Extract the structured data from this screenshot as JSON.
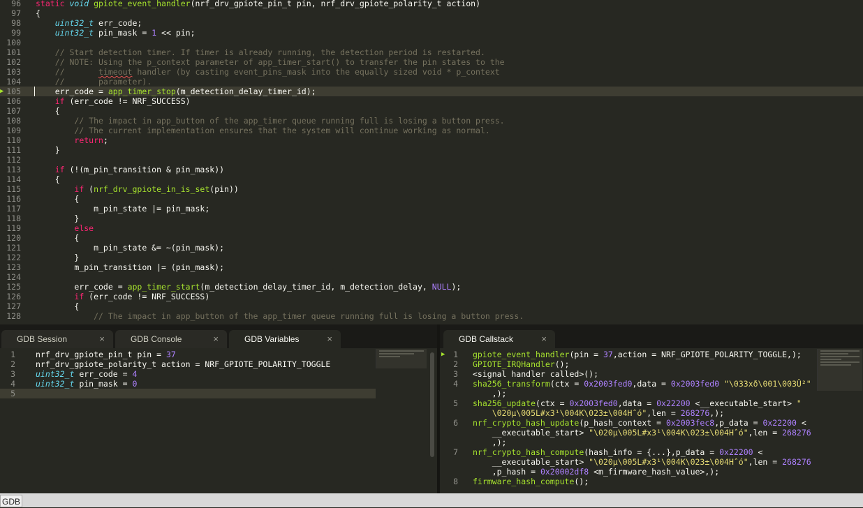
{
  "editor": {
    "lines": [
      {
        "n": "96",
        "t": [
          [
            "kw",
            "static "
          ],
          [
            "typ",
            "void "
          ],
          [
            "fn",
            "gpiote_event_handler"
          ],
          [
            "pln",
            "(nrf_drv_gpiote_pin_t pin, nrf_drv_gpiote_polarity_t action)"
          ]
        ]
      },
      {
        "n": "97",
        "t": [
          [
            "pln",
            "{"
          ]
        ]
      },
      {
        "n": "98",
        "t": [
          [
            "pln",
            "    "
          ],
          [
            "typ",
            "uint32_t"
          ],
          [
            "pln",
            " err_code;"
          ]
        ]
      },
      {
        "n": "99",
        "t": [
          [
            "pln",
            "    "
          ],
          [
            "typ",
            "uint32_t"
          ],
          [
            "pln",
            " pin_mask = "
          ],
          [
            "num",
            "1"
          ],
          [
            "pln",
            " << pin;"
          ]
        ]
      },
      {
        "n": "100",
        "t": []
      },
      {
        "n": "101",
        "t": [
          [
            "cmt",
            "    // Start detection timer. If timer is already running, the detection period is restarted."
          ]
        ]
      },
      {
        "n": "102",
        "t": [
          [
            "cmt",
            "    // NOTE: Using the p_context parameter of app_timer_start() to transfer the pin states to the"
          ]
        ]
      },
      {
        "n": "103",
        "t": [
          [
            "cmt",
            "    //       "
          ],
          [
            "cmt squig",
            "timeout"
          ],
          [
            "cmt",
            " handler (by casting event_pins_mask into the equally sized void * p_context"
          ]
        ]
      },
      {
        "n": "104",
        "t": [
          [
            "cmt",
            "    //       parameter)."
          ]
        ]
      },
      {
        "n": "105",
        "current": true,
        "t": [
          [
            "pln",
            "    err_code = "
          ],
          [
            "fn",
            "app_timer_stop"
          ],
          [
            "pln",
            "(m_detection_delay_timer_id);"
          ]
        ]
      },
      {
        "n": "106",
        "t": [
          [
            "pln",
            "    "
          ],
          [
            "kw",
            "if"
          ],
          [
            "pln",
            " (err_code != NRF_SUCCESS)"
          ]
        ]
      },
      {
        "n": "107",
        "t": [
          [
            "pln",
            "    {"
          ]
        ]
      },
      {
        "n": "108",
        "t": [
          [
            "cmt",
            "        // The impact in app_button of the app_timer queue running full is losing a button press."
          ]
        ]
      },
      {
        "n": "109",
        "t": [
          [
            "cmt",
            "        // The current implementation ensures that the system will continue working as normal."
          ]
        ]
      },
      {
        "n": "110",
        "t": [
          [
            "pln",
            "        "
          ],
          [
            "kw",
            "return"
          ],
          [
            "pln",
            ";"
          ]
        ]
      },
      {
        "n": "111",
        "t": [
          [
            "pln",
            "    }"
          ]
        ]
      },
      {
        "n": "112",
        "t": []
      },
      {
        "n": "113",
        "t": [
          [
            "pln",
            "    "
          ],
          [
            "kw",
            "if"
          ],
          [
            "pln",
            " (!(m_pin_transition & pin_mask))"
          ]
        ]
      },
      {
        "n": "114",
        "t": [
          [
            "pln",
            "    {"
          ]
        ]
      },
      {
        "n": "115",
        "t": [
          [
            "pln",
            "        "
          ],
          [
            "kw",
            "if"
          ],
          [
            "pln",
            " ("
          ],
          [
            "fn",
            "nrf_drv_gpiote_in_is_set"
          ],
          [
            "pln",
            "(pin))"
          ]
        ]
      },
      {
        "n": "116",
        "t": [
          [
            "pln",
            "        {"
          ]
        ]
      },
      {
        "n": "117",
        "t": [
          [
            "pln",
            "            m_pin_state |= pin_mask;"
          ]
        ]
      },
      {
        "n": "118",
        "t": [
          [
            "pln",
            "        }"
          ]
        ]
      },
      {
        "n": "119",
        "t": [
          [
            "pln",
            "        "
          ],
          [
            "kw",
            "else"
          ]
        ]
      },
      {
        "n": "120",
        "t": [
          [
            "pln",
            "        {"
          ]
        ]
      },
      {
        "n": "121",
        "t": [
          [
            "pln",
            "            m_pin_state &= ~(pin_mask);"
          ]
        ]
      },
      {
        "n": "122",
        "t": [
          [
            "pln",
            "        }"
          ]
        ]
      },
      {
        "n": "123",
        "t": [
          [
            "pln",
            "        m_pin_transition |= (pin_mask);"
          ]
        ]
      },
      {
        "n": "124",
        "t": []
      },
      {
        "n": "125",
        "t": [
          [
            "pln",
            "        err_code = "
          ],
          [
            "fn",
            "app_timer_start"
          ],
          [
            "pln",
            "(m_detection_delay_timer_id, m_detection_delay, "
          ],
          [
            "cst",
            "NULL"
          ],
          [
            "pln",
            ");"
          ]
        ]
      },
      {
        "n": "126",
        "t": [
          [
            "pln",
            "        "
          ],
          [
            "kw",
            "if"
          ],
          [
            "pln",
            " (err_code != NRF_SUCCESS)"
          ]
        ]
      },
      {
        "n": "127",
        "t": [
          [
            "pln",
            "        {"
          ]
        ]
      },
      {
        "n": "128",
        "t": [
          [
            "cmt",
            "            // The impact in app_button of the app_timer queue running full is losing a button press."
          ]
        ]
      }
    ]
  },
  "tabs_left": [
    {
      "label": "GDB Session",
      "close": "×"
    },
    {
      "label": "GDB Console",
      "close": "×"
    },
    {
      "label": "GDB Variables",
      "close": "×"
    }
  ],
  "tabs_right": [
    {
      "label": "GDB Callstack",
      "close": "×"
    }
  ],
  "variables": {
    "lines": [
      {
        "n": "1",
        "t": [
          [
            "pln",
            "nrf_drv_gpiote_pin_t pin = "
          ],
          [
            "num",
            "37"
          ]
        ]
      },
      {
        "n": "2",
        "t": [
          [
            "pln",
            "nrf_drv_gpiote_polarity_t action = NRF_GPIOTE_POLARITY_TOGGLE"
          ]
        ]
      },
      {
        "n": "3",
        "t": [
          [
            "typ",
            "uint32_t"
          ],
          [
            "pln",
            " err_code = "
          ],
          [
            "num",
            "4"
          ]
        ]
      },
      {
        "n": "4",
        "t": [
          [
            "typ",
            "uint32_t"
          ],
          [
            "pln",
            " pin_mask = "
          ],
          [
            "num",
            "0"
          ]
        ]
      },
      {
        "n": "5",
        "current": true,
        "t": []
      }
    ]
  },
  "callstack": {
    "lines": [
      {
        "n": "1",
        "t": [
          [
            "fn",
            "gpiote_event_handler"
          ],
          [
            "pln",
            "(pin = "
          ],
          [
            "num",
            "37"
          ],
          [
            "pln",
            ",action = NRF_GPIOTE_POLARITY_TOGGLE,);"
          ]
        ]
      },
      {
        "n": "2",
        "t": [
          [
            "fn",
            "GPIOTE_IRQHandler"
          ],
          [
            "pln",
            "();"
          ]
        ]
      },
      {
        "n": "3",
        "t": [
          [
            "pln",
            "<signal handler called>();"
          ]
        ]
      },
      {
        "n": "4",
        "t": [
          [
            "fn",
            "sha256_transform"
          ],
          [
            "pln",
            "(ctx = "
          ],
          [
            "num",
            "0x2003fed0"
          ],
          [
            "pln",
            ",data = "
          ],
          [
            "num",
            "0x2003fed0"
          ],
          [
            "pln",
            " "
          ],
          [
            "str",
            "\"\\033xð\\001\\003Û²\""
          ]
        ]
      },
      {
        "n": "",
        "t": [
          [
            "pln",
            "    ,);"
          ]
        ]
      },
      {
        "n": "5",
        "t": [
          [
            "fn",
            "sha256_update"
          ],
          [
            "pln",
            "(ctx = "
          ],
          [
            "num",
            "0x2003fed0"
          ],
          [
            "pln",
            ",data = "
          ],
          [
            "num",
            "0x22200"
          ],
          [
            "pln",
            " <__executable_start> "
          ],
          [
            "str",
            "\""
          ]
        ]
      },
      {
        "n": "",
        "t": [
          [
            "str",
            "    \\020µ\\005L#x3¹\\004K\\023±\\004Hˆó\""
          ],
          [
            "pln",
            ",len = "
          ],
          [
            "num",
            "268276"
          ],
          [
            "pln",
            ",);"
          ]
        ]
      },
      {
        "n": "6",
        "t": [
          [
            "fn",
            "nrf_crypto_hash_update"
          ],
          [
            "pln",
            "(p_hash_context = "
          ],
          [
            "num",
            "0x2003fec8"
          ],
          [
            "pln",
            ",p_data = "
          ],
          [
            "num",
            "0x22200"
          ],
          [
            "pln",
            " <"
          ]
        ]
      },
      {
        "n": "",
        "t": [
          [
            "pln",
            "    __executable_start> "
          ],
          [
            "str",
            "\"\\020µ\\005L#x3¹\\004K\\023±\\004Hˆó\""
          ],
          [
            "pln",
            ",len = "
          ],
          [
            "num",
            "268276"
          ]
        ]
      },
      {
        "n": "",
        "t": [
          [
            "pln",
            "    ,);"
          ]
        ]
      },
      {
        "n": "7",
        "t": [
          [
            "fn",
            "nrf_crypto_hash_compute"
          ],
          [
            "pln",
            "(hash_info = {...},p_data = "
          ],
          [
            "num",
            "0x22200"
          ],
          [
            "pln",
            " <"
          ]
        ]
      },
      {
        "n": "",
        "t": [
          [
            "pln",
            "    __executable_start> "
          ],
          [
            "str",
            "\"\\020µ\\005L#x3¹\\004K\\023±\\004Hˆó\""
          ],
          [
            "pln",
            ",len = "
          ],
          [
            "num",
            "268276"
          ]
        ]
      },
      {
        "n": "",
        "t": [
          [
            "pln",
            "    ,p_hash = "
          ],
          [
            "num",
            "0x20002df8"
          ],
          [
            "pln",
            " <m_firmware_hash_value>,);"
          ]
        ]
      },
      {
        "n": "8",
        "t": [
          [
            "fn",
            "firmware_hash_compute"
          ],
          [
            "pln",
            "();"
          ]
        ]
      }
    ]
  },
  "statusbar": {
    "label": "GDB"
  }
}
